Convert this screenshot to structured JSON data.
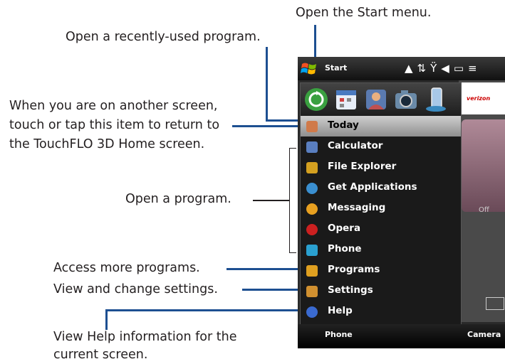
{
  "callouts": {
    "start_menu": "Open the Start menu.",
    "recent": "Open a recently-used program.",
    "today_1": "When you are on another screen,",
    "today_2": "touch or tap this item to return to",
    "today_3": "the TouchFLO 3D Home screen.",
    "open_program": "Open a program.",
    "more_programs": "Access more programs.",
    "settings": "View and change settings.",
    "help_1": "View Help information for the",
    "help_2": "current screen."
  },
  "phone": {
    "title": "Start",
    "carrier": "verizon",
    "off_label": "Off",
    "menu_items": [
      {
        "label": "Today",
        "icon": "today-icon",
        "color": "#d07a4a"
      },
      {
        "label": "Calculator",
        "icon": "calculator-icon",
        "color": "#5a7fc0"
      },
      {
        "label": "File Explorer",
        "icon": "file-explorer-icon",
        "color": "#d4a020"
      },
      {
        "label": "Get Applications",
        "icon": "get-applications-icon",
        "color": "#3a8fd0"
      },
      {
        "label": "Messaging",
        "icon": "messaging-icon",
        "color": "#e8a020"
      },
      {
        "label": "Opera",
        "icon": "opera-icon",
        "color": "#cc2020"
      },
      {
        "label": "Phone",
        "icon": "phone-icon",
        "color": "#2aa0d0"
      },
      {
        "label": "Programs",
        "icon": "programs-icon",
        "color": "#e0a020"
      },
      {
        "label": "Settings",
        "icon": "settings-icon",
        "color": "#d09030"
      },
      {
        "label": "Help",
        "icon": "help-icon",
        "color": "#3a6ad0"
      }
    ],
    "recent_icons": [
      "refresh-icon",
      "calendar-icon",
      "contacts-icon",
      "camera-icon",
      "phone-device-icon"
    ],
    "softkeys": {
      "left": "Phone",
      "right": "Camera"
    }
  },
  "colors": {
    "callout_line": "#1d4f91",
    "selected_item": "#b4b4b4"
  }
}
